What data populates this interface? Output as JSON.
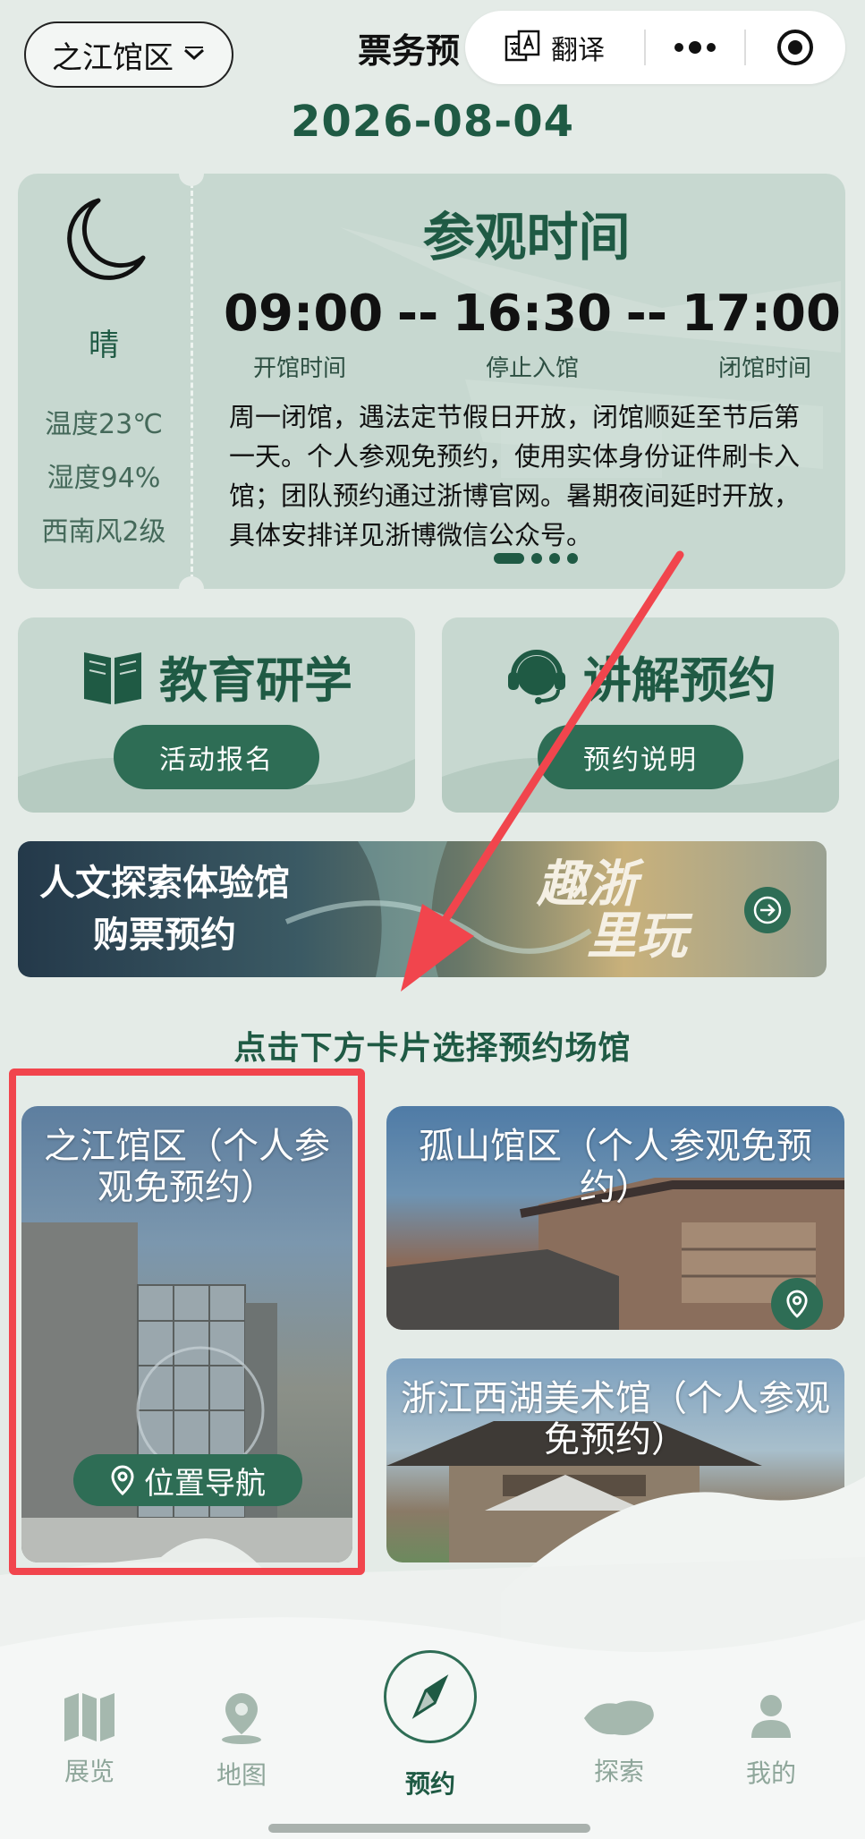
{
  "header": {
    "venue_selector": "之江馆区",
    "title": "票务预",
    "translate_label": "翻译"
  },
  "date": "2026-08-04",
  "weather": {
    "condition": "晴",
    "temperature": "温度23℃",
    "humidity": "湿度94%",
    "wind": "西南风2级"
  },
  "hours": {
    "title": "参观时间",
    "open_time": "09:00",
    "last_entry_time": "16:30",
    "close_time": "17:00",
    "separator": "--",
    "open_label": "开馆时间",
    "last_entry_label": "停止入馆",
    "close_label": "闭馆时间",
    "notice": "周一闭馆，遇法定节假日开放，闭馆顺延至节后第一天。个人参观免预约，使用实体身份证件刷卡入馆；团队预约通过浙博官网。暑期夜间延时开放，具体安排详见浙博微信公众号。"
  },
  "services": [
    {
      "title": "教育研学",
      "button": "活动报名"
    },
    {
      "title": "讲解预约",
      "button": "预约说明"
    }
  ],
  "banner": {
    "line1": "人文探索体验馆",
    "line2": "购票预约",
    "brand_line1": "趣浙",
    "brand_line2": "里玩"
  },
  "hint": "点击下方卡片选择预约场馆",
  "venues": [
    {
      "name": "之江馆区（个人参观免预约）",
      "nav_label": "位置导航"
    },
    {
      "name": "孤山馆区（个人参观免预约）"
    },
    {
      "name": "浙江西湖美术馆（个人参观免预约）"
    }
  ],
  "bottom_nav": [
    {
      "label": "展览"
    },
    {
      "label": "地图"
    },
    {
      "label": "预约",
      "active": true
    },
    {
      "label": "探索"
    },
    {
      "label": "我的"
    }
  ],
  "colors": {
    "brand_green": "#1f5a44",
    "button_green": "#2e6d55",
    "card_bg": "#c7d8d0",
    "page_bg": "#e4ebe7",
    "highlight_red": "#f1454d"
  }
}
